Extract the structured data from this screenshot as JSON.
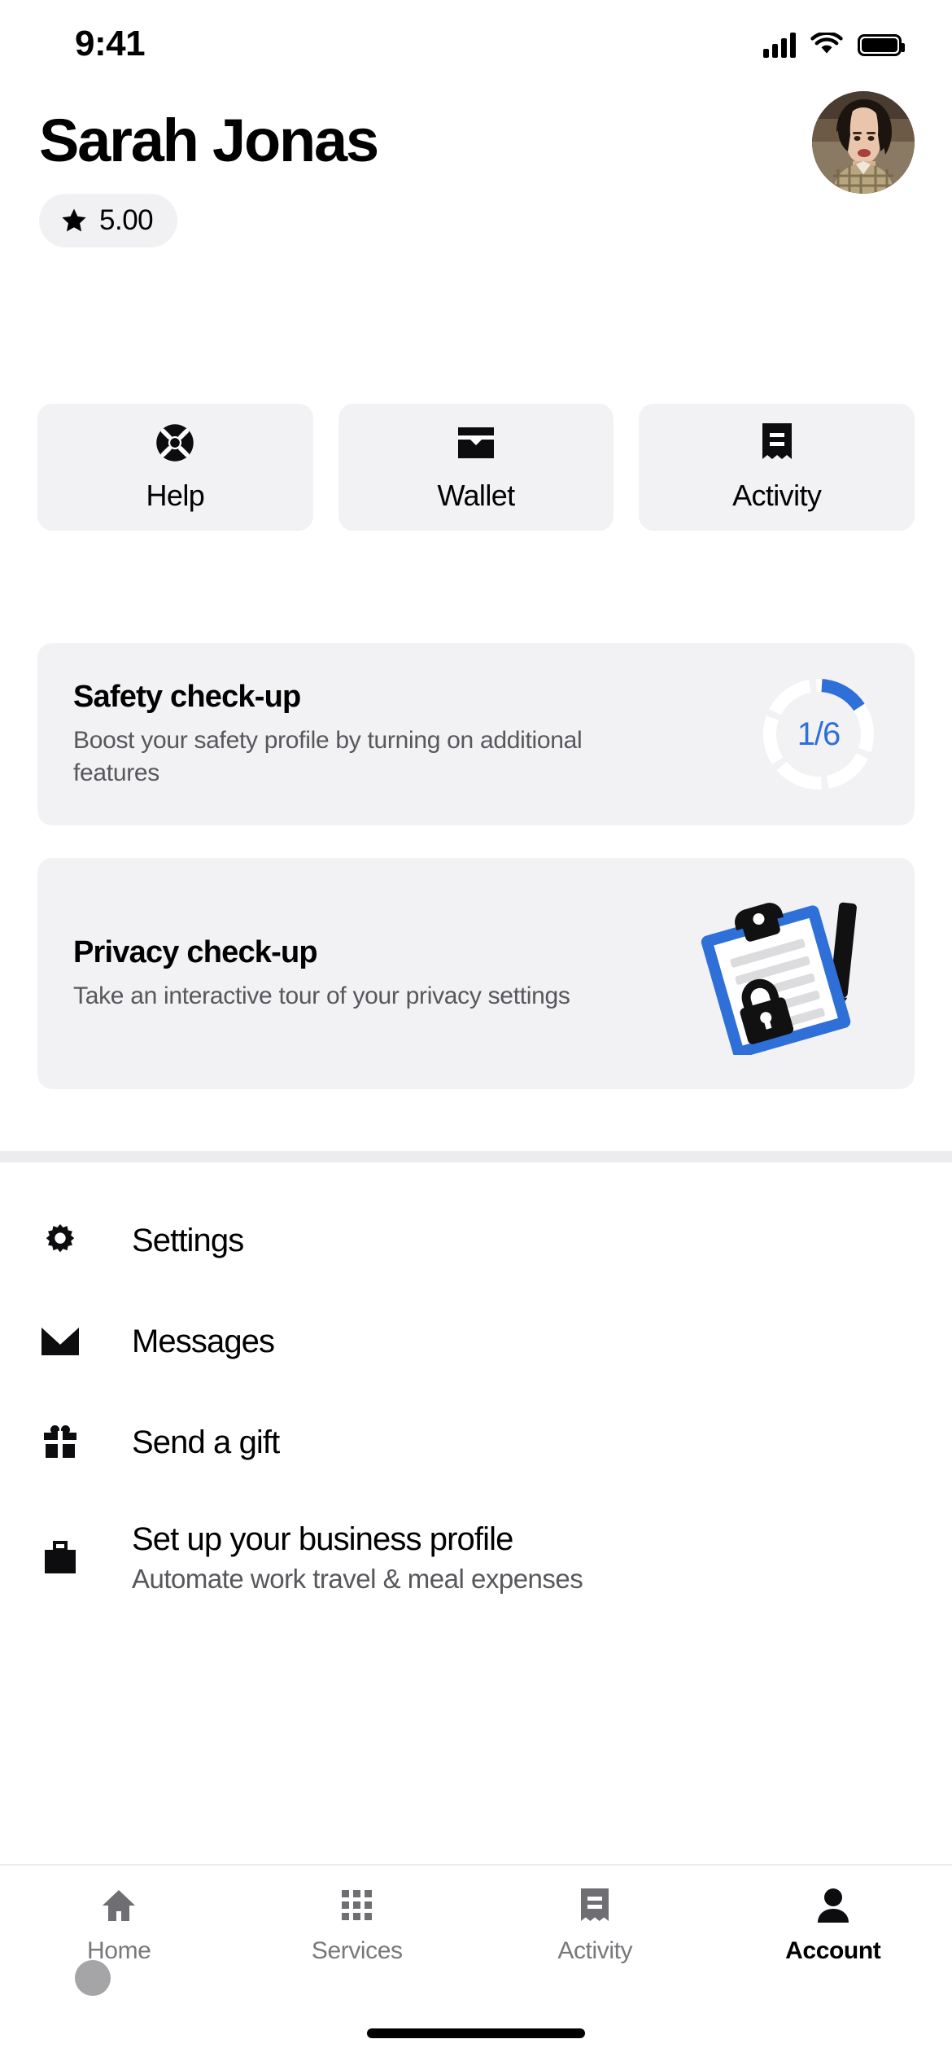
{
  "status_bar": {
    "time": "9:41",
    "cellular_icon": "cellular-signal-icon",
    "wifi_icon": "wifi-icon",
    "battery_icon": "battery-full-icon"
  },
  "header": {
    "name": "Sarah Jonas",
    "rating": "5.00",
    "rating_icon": "star-icon",
    "avatar_name": "profile-photo"
  },
  "quick_actions": [
    {
      "label": "Help",
      "icon": "life-ring-icon"
    },
    {
      "label": "Wallet",
      "icon": "wallet-icon"
    },
    {
      "label": "Activity",
      "icon": "receipt-icon"
    }
  ],
  "promos": {
    "safety": {
      "title": "Safety check-up",
      "subtitle": "Boost your safety profile by turning on additional features",
      "progress_label": "1/6",
      "progress_done": 1,
      "progress_total": 6,
      "accent_color": "#2f6fd8",
      "track_color": "#ffffff"
    },
    "privacy": {
      "title": "Privacy check-up",
      "subtitle": "Take an interactive tour of your privacy settings",
      "illustration": "clipboard-lock-illustration"
    }
  },
  "menu": [
    {
      "label": "Settings",
      "sub": "",
      "icon": "gear-icon"
    },
    {
      "label": "Messages",
      "sub": "",
      "icon": "envelope-icon"
    },
    {
      "label": "Send a gift",
      "sub": "",
      "icon": "gift-icon"
    },
    {
      "label": "Set up your business profile",
      "sub": "Automate work travel & meal expenses",
      "icon": "briefcase-icon"
    }
  ],
  "tabs": [
    {
      "label": "Home",
      "icon": "home-icon",
      "active": false
    },
    {
      "label": "Services",
      "icon": "grid-icon",
      "active": false
    },
    {
      "label": "Activity",
      "icon": "receipt-icon",
      "active": false
    },
    {
      "label": "Account",
      "icon": "person-icon",
      "active": true
    }
  ],
  "colors": {
    "card_bg": "#f2f2f4",
    "accent_blue": "#2f6fd8",
    "text_primary": "#000000",
    "text_secondary": "#57575c",
    "tab_inactive": "#78787d"
  }
}
